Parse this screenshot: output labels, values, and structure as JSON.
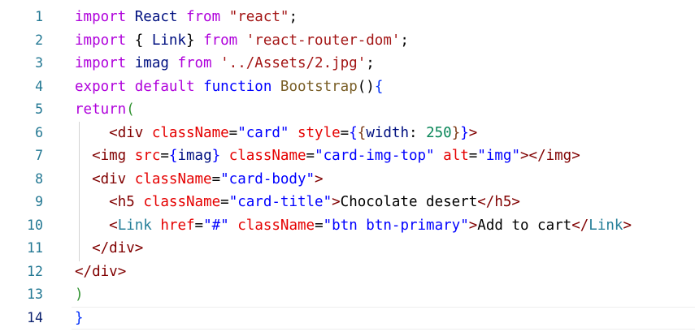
{
  "editor": {
    "top_fragment": "",
    "lines": [
      {
        "num": "1",
        "tokens": [
          {
            "t": "import",
            "c": "ctl"
          },
          {
            "t": " React ",
            "c": "var"
          },
          {
            "t": "from",
            "c": "ctl"
          },
          {
            "t": " ",
            "c": "plain"
          },
          {
            "t": "\"react\"",
            "c": "str"
          },
          {
            "t": ";",
            "c": "plain"
          }
        ]
      },
      {
        "num": "2",
        "tokens": [
          {
            "t": "import",
            "c": "ctl"
          },
          {
            "t": " { ",
            "c": "plain"
          },
          {
            "t": "Link",
            "c": "var"
          },
          {
            "t": "} ",
            "c": "plain"
          },
          {
            "t": "from",
            "c": "ctl"
          },
          {
            "t": " ",
            "c": "plain"
          },
          {
            "t": "'react-router-dom'",
            "c": "str"
          },
          {
            "t": ";",
            "c": "plain"
          }
        ]
      },
      {
        "num": "3",
        "tokens": [
          {
            "t": "import",
            "c": "ctl"
          },
          {
            "t": " imag ",
            "c": "var"
          },
          {
            "t": "from",
            "c": "ctl"
          },
          {
            "t": " ",
            "c": "plain"
          },
          {
            "t": "'../Assets/2.jpg'",
            "c": "str"
          },
          {
            "t": ";",
            "c": "plain"
          }
        ]
      },
      {
        "num": "4",
        "tokens": [
          {
            "t": "export",
            "c": "ctl"
          },
          {
            "t": " ",
            "c": "plain"
          },
          {
            "t": "default",
            "c": "ctl"
          },
          {
            "t": " ",
            "c": "plain"
          },
          {
            "t": "function",
            "c": "kw"
          },
          {
            "t": " ",
            "c": "plain"
          },
          {
            "t": "Bootstrap",
            "c": "fn"
          },
          {
            "t": "()",
            "c": "plain"
          },
          {
            "t": "{",
            "c": "brace"
          }
        ]
      },
      {
        "num": "5",
        "tokens": [
          {
            "t": "return",
            "c": "ctl"
          },
          {
            "t": "(",
            "c": "brace2"
          }
        ]
      },
      {
        "num": "6",
        "tokens": [
          {
            "t": "    <",
            "c": "tag"
          },
          {
            "t": "div",
            "c": "tag"
          },
          {
            "t": " ",
            "c": "plain"
          },
          {
            "t": "className",
            "c": "attr"
          },
          {
            "t": "=",
            "c": "plain"
          },
          {
            "t": "\"card\"",
            "c": "kw"
          },
          {
            "t": " ",
            "c": "plain"
          },
          {
            "t": "style",
            "c": "attr"
          },
          {
            "t": "=",
            "c": "plain"
          },
          {
            "t": "{",
            "c": "kw"
          },
          {
            "t": "{",
            "c": "brace3"
          },
          {
            "t": "width",
            "c": "var"
          },
          {
            "t": ": ",
            "c": "plain"
          },
          {
            "t": "250",
            "c": "num"
          },
          {
            "t": "}",
            "c": "brace3"
          },
          {
            "t": "}",
            "c": "kw"
          },
          {
            "t": ">",
            "c": "tag"
          }
        ]
      },
      {
        "num": "7",
        "tokens": [
          {
            "t": "  <",
            "c": "tag"
          },
          {
            "t": "img",
            "c": "tag"
          },
          {
            "t": " ",
            "c": "plain"
          },
          {
            "t": "src",
            "c": "attr"
          },
          {
            "t": "=",
            "c": "plain"
          },
          {
            "t": "{",
            "c": "kw"
          },
          {
            "t": "imag",
            "c": "var"
          },
          {
            "t": "}",
            "c": "kw"
          },
          {
            "t": " ",
            "c": "plain"
          },
          {
            "t": "className",
            "c": "attr"
          },
          {
            "t": "=",
            "c": "plain"
          },
          {
            "t": "\"card-img-top\"",
            "c": "kw"
          },
          {
            "t": " ",
            "c": "plain"
          },
          {
            "t": "alt",
            "c": "attr"
          },
          {
            "t": "=",
            "c": "plain"
          },
          {
            "t": "\"img\"",
            "c": "kw"
          },
          {
            "t": "></",
            "c": "tag"
          },
          {
            "t": "img",
            "c": "tag"
          },
          {
            "t": ">",
            "c": "tag"
          }
        ]
      },
      {
        "num": "8",
        "tokens": [
          {
            "t": "  <",
            "c": "tag"
          },
          {
            "t": "div",
            "c": "tag"
          },
          {
            "t": " ",
            "c": "plain"
          },
          {
            "t": "className",
            "c": "attr"
          },
          {
            "t": "=",
            "c": "plain"
          },
          {
            "t": "\"card-body\"",
            "c": "kw"
          },
          {
            "t": ">",
            "c": "tag"
          }
        ]
      },
      {
        "num": "9",
        "tokens": [
          {
            "t": "    <",
            "c": "tag"
          },
          {
            "t": "h5",
            "c": "tag"
          },
          {
            "t": " ",
            "c": "plain"
          },
          {
            "t": "className",
            "c": "attr"
          },
          {
            "t": "=",
            "c": "plain"
          },
          {
            "t": "\"card-title\"",
            "c": "kw"
          },
          {
            "t": ">",
            "c": "tag"
          },
          {
            "t": "Chocolate desert",
            "c": "plain"
          },
          {
            "t": "</",
            "c": "tag"
          },
          {
            "t": "h5",
            "c": "tag"
          },
          {
            "t": ">",
            "c": "tag"
          }
        ]
      },
      {
        "num": "10",
        "tokens": [
          {
            "t": "    <",
            "c": "tag"
          },
          {
            "t": "Link",
            "c": "type"
          },
          {
            "t": " ",
            "c": "plain"
          },
          {
            "t": "href",
            "c": "attr"
          },
          {
            "t": "=",
            "c": "plain"
          },
          {
            "t": "\"#\"",
            "c": "kw"
          },
          {
            "t": " ",
            "c": "plain"
          },
          {
            "t": "className",
            "c": "attr"
          },
          {
            "t": "=",
            "c": "plain"
          },
          {
            "t": "\"btn btn-primary\"",
            "c": "kw"
          },
          {
            "t": ">",
            "c": "tag"
          },
          {
            "t": "Add to cart",
            "c": "plain"
          },
          {
            "t": "</",
            "c": "tag"
          },
          {
            "t": "Link",
            "c": "type"
          },
          {
            "t": ">",
            "c": "tag"
          }
        ]
      },
      {
        "num": "11",
        "tokens": [
          {
            "t": "  </",
            "c": "tag"
          },
          {
            "t": "div",
            "c": "tag"
          },
          {
            "t": ">",
            "c": "tag"
          }
        ]
      },
      {
        "num": "12",
        "tokens": [
          {
            "t": "</",
            "c": "tag"
          },
          {
            "t": "div",
            "c": "tag"
          },
          {
            "t": ">",
            "c": "tag"
          }
        ]
      },
      {
        "num": "13",
        "tokens": [
          {
            "t": ")",
            "c": "brace2"
          }
        ]
      },
      {
        "num": "14",
        "current": true,
        "tokens": [
          {
            "t": "}",
            "c": "brace"
          }
        ]
      }
    ]
  }
}
